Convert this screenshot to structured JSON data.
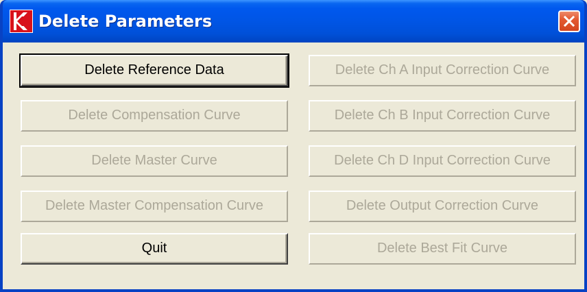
{
  "window": {
    "title": "Delete Parameters",
    "icon": "app-logo-icon",
    "close_icon": "close-icon"
  },
  "buttons": {
    "left": [
      {
        "label": "Delete Reference Data",
        "enabled": true
      },
      {
        "label": "Delete Compensation Curve",
        "enabled": false
      },
      {
        "label": "Delete Master Curve",
        "enabled": false
      },
      {
        "label": "Delete Master Compensation Curve",
        "enabled": false
      },
      {
        "label": "Quit",
        "enabled": true
      }
    ],
    "right": [
      {
        "label": "Delete Ch A Input Correction Curve",
        "enabled": false
      },
      {
        "label": "Delete Ch B Input Correction Curve",
        "enabled": false
      },
      {
        "label": "Delete Ch D Input Correction Curve",
        "enabled": false
      },
      {
        "label": "Delete Output Correction Curve",
        "enabled": false
      },
      {
        "label": "Delete Best Fit Curve",
        "enabled": false
      }
    ]
  },
  "colors": {
    "titlebar": "#0055e5",
    "client": "#ece9d8",
    "disabled_text": "#aca899",
    "close_button": "#e35a32"
  }
}
